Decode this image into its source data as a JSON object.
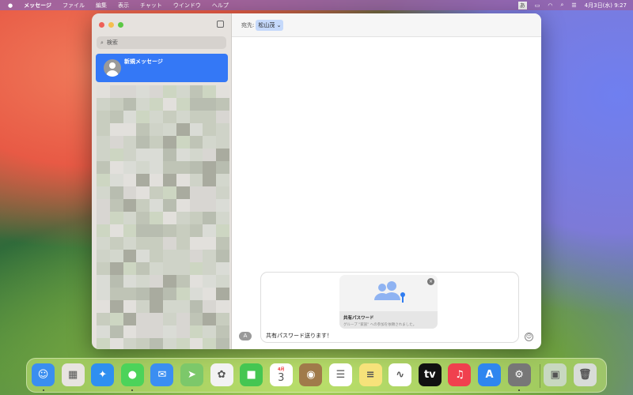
{
  "menubar": {
    "app": "メッセージ",
    "items": [
      "ファイル",
      "編集",
      "表示",
      "チャット",
      "ウインドウ",
      "ヘルプ"
    ],
    "input_mode": "あ",
    "datetime": "4月3日(水) 9:27"
  },
  "sidebar": {
    "search_placeholder": "検索",
    "selected_item": "新規メッセージ"
  },
  "header": {
    "to_label": "宛先:",
    "recipient": "松山茂"
  },
  "compose": {
    "card_title": "共有パスワード",
    "card_subtitle": "グループ \"家族\" への参加を依頼されました。",
    "message": "共有パスワード送ります！"
  },
  "dock": {
    "items": [
      {
        "name": "finder",
        "color": "#3a8ef0",
        "glyph": "☺",
        "running": true
      },
      {
        "name": "launchpad",
        "color": "#e8e4e0",
        "glyph": "▦"
      },
      {
        "name": "safari",
        "color": "#2f8ff0",
        "glyph": "✦"
      },
      {
        "name": "messages",
        "color": "#4cd35a",
        "glyph": "●",
        "running": true
      },
      {
        "name": "mail",
        "color": "#3b8ef2",
        "glyph": "✉"
      },
      {
        "name": "maps",
        "color": "#7cc86a",
        "glyph": "➤"
      },
      {
        "name": "photos",
        "color": "#f2f2f2",
        "glyph": "✿"
      },
      {
        "name": "facetime",
        "color": "#45c652",
        "glyph": "■"
      },
      {
        "name": "calendar",
        "color": "#ffffff",
        "glyph": "3",
        "label": "4月"
      },
      {
        "name": "contacts",
        "color": "#a07a4a",
        "glyph": "◉"
      },
      {
        "name": "reminders",
        "color": "#ffffff",
        "glyph": "☰"
      },
      {
        "name": "notes",
        "color": "#f6e27a",
        "glyph": "≡"
      },
      {
        "name": "freeform",
        "color": "#ffffff",
        "glyph": "∿"
      },
      {
        "name": "apple-tv",
        "color": "#111111",
        "glyph": "tv"
      },
      {
        "name": "music",
        "color": "#f0404e",
        "glyph": "♫"
      },
      {
        "name": "app-store",
        "color": "#2f86ef",
        "glyph": "A"
      },
      {
        "name": "system-settings",
        "color": "#777777",
        "glyph": "⚙",
        "running": true
      },
      {
        "name": "downloads-stack",
        "color": "#c8d8c0",
        "glyph": "▣"
      },
      {
        "name": "trash",
        "color": "#d8dcd8",
        "glyph": "🗑"
      }
    ]
  },
  "colors": {
    "accent": "#3478f6"
  }
}
